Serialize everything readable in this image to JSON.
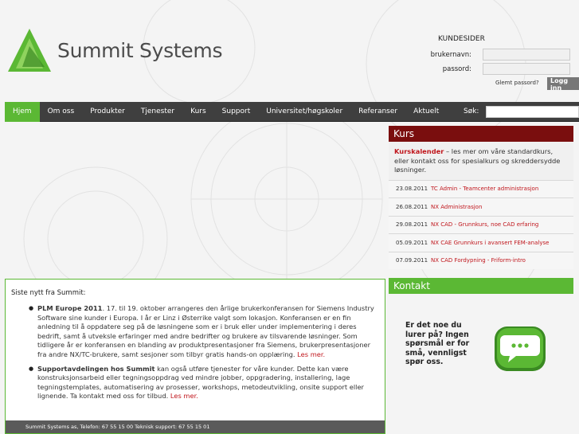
{
  "brand": {
    "name": "Summit Systems"
  },
  "login": {
    "title": "KUNDESIDER",
    "username_label": "brukernavn:",
    "password_label": "passord:",
    "forgot_label": "Glemt passord?",
    "button_label": "Logg inn"
  },
  "nav": {
    "items": [
      {
        "label": "Hjem",
        "active": true
      },
      {
        "label": "Om oss"
      },
      {
        "label": "Produkter"
      },
      {
        "label": "Tjenester"
      },
      {
        "label": "Kurs"
      },
      {
        "label": "Support"
      },
      {
        "label": "Universitet/høgskoler"
      },
      {
        "label": "Referanser"
      },
      {
        "label": "Aktuelt"
      }
    ],
    "search_label": "Søk:"
  },
  "kurs": {
    "heading": "Kurs",
    "intro_highlight": "Kurskalender",
    "intro_text": " – les mer om våre standardkurs, eller kontakt oss for spesialkurs og skreddersydde løsninger.",
    "items": [
      {
        "date": "23.08.2011",
        "title": "TC Admin - Teamcenter administrasjon"
      },
      {
        "date": "26.08.2011",
        "title": "NX Administrasjon"
      },
      {
        "date": "29.08.2011",
        "title": "NX CAD - Grunnkurs, noe CAD erfaring"
      },
      {
        "date": "05.09.2011",
        "title": "NX CAE Grunnkurs i avansert FEM-analyse"
      },
      {
        "date": "07.09.2011",
        "title": "NX CAD Fordypning - Friform-intro"
      }
    ]
  },
  "kontakt": {
    "heading": "Kontakt",
    "lines": [
      "Er det noe du",
      "lurer på? Ingen",
      "spørsmål er for",
      "små, vennligst",
      "spør oss."
    ]
  },
  "news": {
    "title": "Siste nytt fra Summit:",
    "items": [
      {
        "lead": "PLM Europe 2011",
        "text": ". 17. til 19. oktober arrangeres den årlige brukerkonferansen for Siemens Industry Software sine kunder i Europa. I år er Linz i Østerrike valgt som lokasjon. Konferansen er en fin anledning til å oppdatere seg på de løsningene som er i bruk eller under implementering i deres bedrift, samt å utveksle erfaringer med andre bedrifter og brukere av tilsvarende løsninger. Som tidligere år er konferansen en blanding av produktpresentasjoner fra Siemens, brukerpresentasjoner fra andre NX/TC-brukere, samt sesjoner som tilbyr gratis hands-on opplæring. ",
        "more": "Les mer."
      },
      {
        "lead": "Supportavdelingen hos Summit",
        "text": " kan også utføre tjenester for våre kunder. Dette kan være konstruksjonsarbeid eller tegningsoppdrag ved mindre jobber, oppgradering, installering, lage tegningstemplates, automatisering av prosesser, workshops, metodeutvikling, onsite support eller lignende. Ta kontakt med oss for tilbud. ",
        "more": "Les mer."
      }
    ]
  },
  "footer": {
    "text": "Summit Systems as, Telefon: 67 55 15 00 Teknisk support: 67 55 15 01"
  },
  "colors": {
    "green": "#5bb834",
    "dark_red": "#7a0e0e",
    "nav_bg": "#3f3f3f",
    "link_red": "#c0161c"
  }
}
